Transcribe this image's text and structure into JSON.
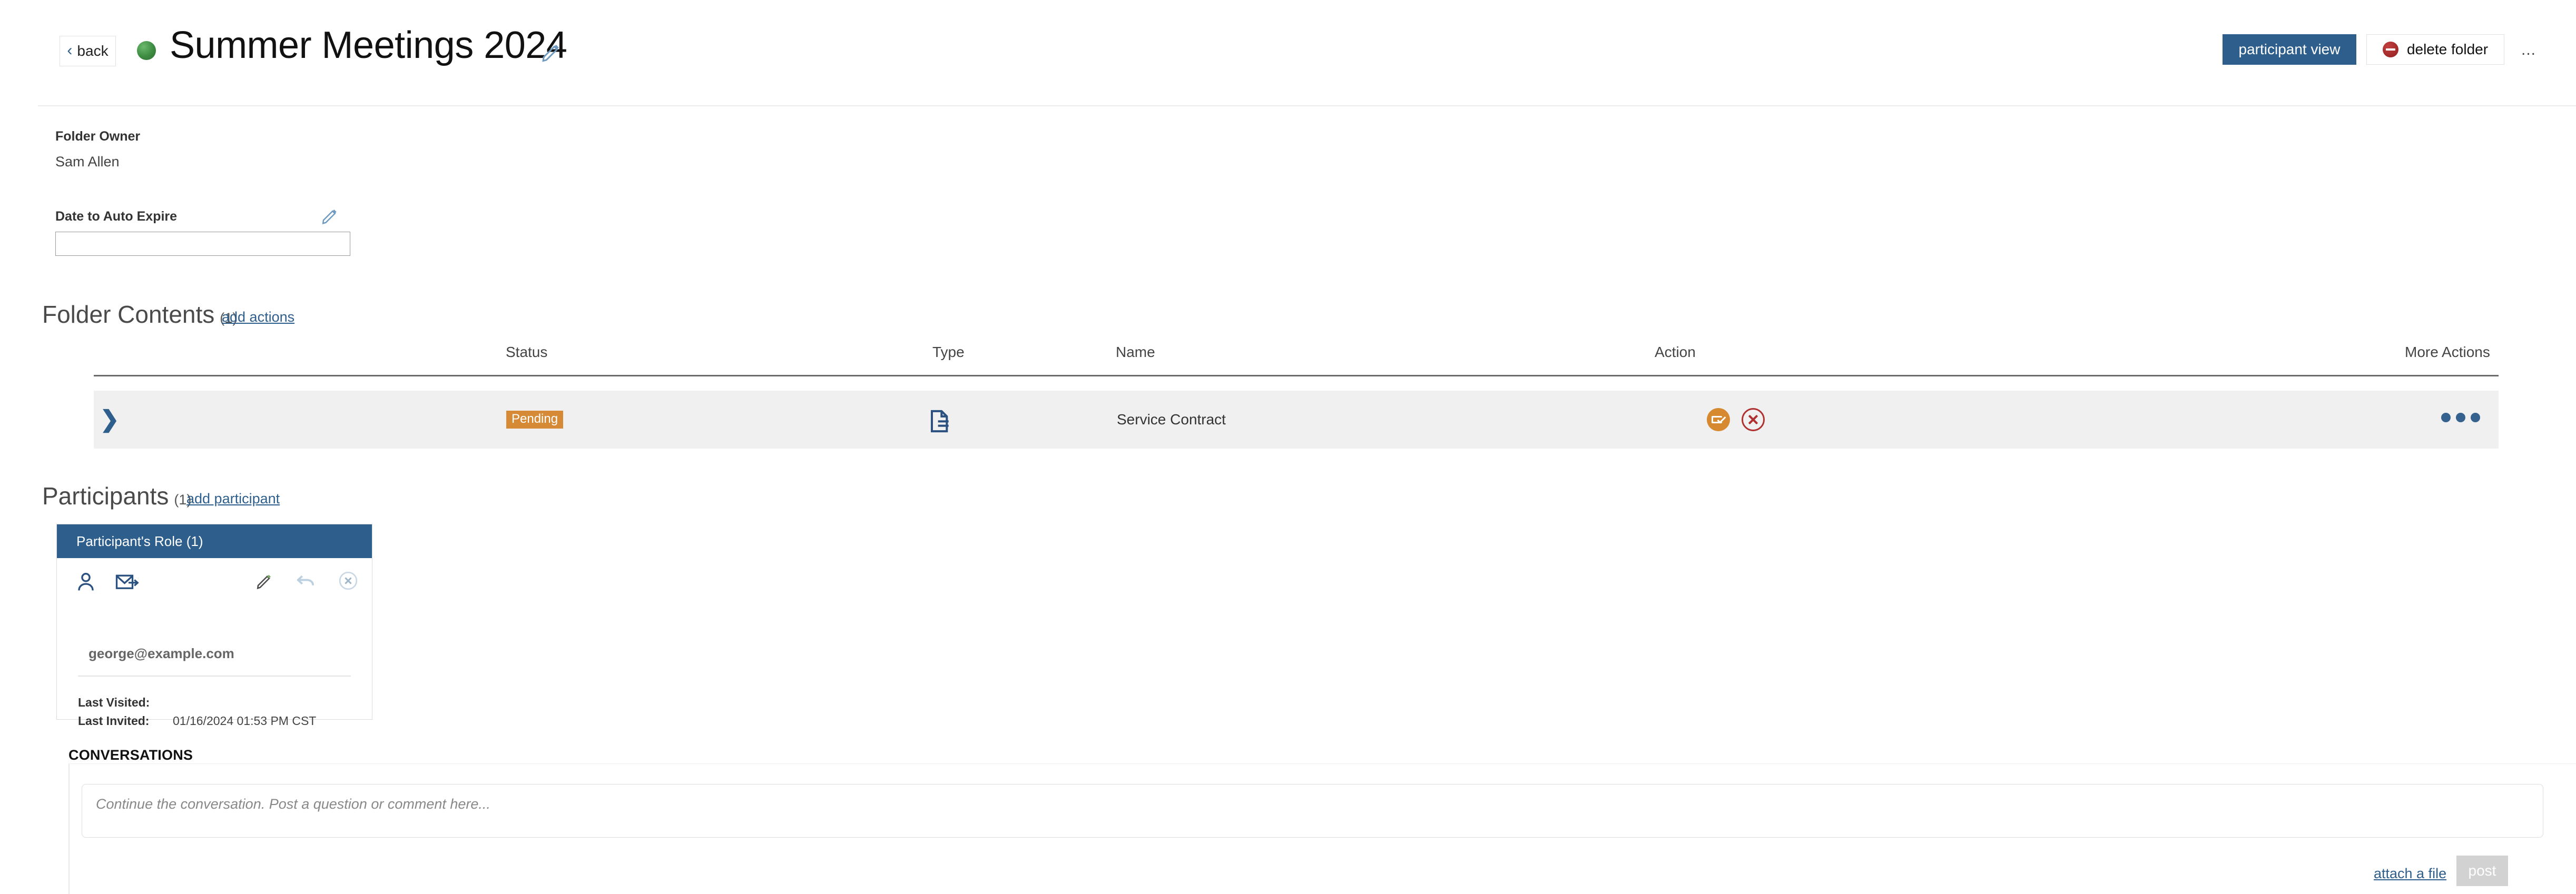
{
  "header": {
    "back_label": "back",
    "status_dot_color": "#3e8e41",
    "title": "Summer Meetings 2024",
    "edit_icon": "pencil-icon",
    "participant_view_label": "participant view",
    "delete_folder_label": "delete folder",
    "delete_icon": "deny-icon",
    "overflow_label": "...",
    "accent_color": "#2e5f8c"
  },
  "folder_meta": {
    "owner_label": "Folder Owner",
    "owner_value": "Sam Allen",
    "expire_label": "Date to Auto Expire",
    "expire_value": "",
    "expire_placeholder": "",
    "expire_edit_icon": "pencil-icon"
  },
  "folder_contents": {
    "title": "Folder Contents",
    "count": "(1)",
    "add_actions_label": "add actions",
    "columns": [
      "Status",
      "Type",
      "Name",
      "Action",
      "More Actions"
    ],
    "rows": [
      {
        "expand_icon": "chevron-right-icon",
        "status": "Pending",
        "status_color": "#d68a36",
        "type_icon": "document-icon",
        "name": "Service Contract",
        "actions": [
          "sign-icon",
          "decline-icon"
        ],
        "more_actions_icon": "ellipsis-icon"
      }
    ]
  },
  "participants": {
    "title": "Participants",
    "count": "(1)",
    "add_participant_label": "add participant",
    "cards": [
      {
        "role_header": "Participant's Role (1)",
        "toolbar_left_icons": [
          "person-icon",
          "send-email-icon"
        ],
        "toolbar_right_icons": [
          "pencil-icon",
          "undo-icon",
          "remove-circle-icon"
        ],
        "email": "george@example.com",
        "last_visited_label": "Last Visited:",
        "last_visited_value": "",
        "last_invited_label": "Last Invited:",
        "last_invited_value": "01/16/2024 01:53 PM CST"
      }
    ]
  },
  "conversations": {
    "label": "CONVERSATIONS",
    "input_value": "",
    "input_placeholder": "Continue the conversation. Post a question or comment here...",
    "attach_label": "attach a file",
    "post_label": "post"
  }
}
